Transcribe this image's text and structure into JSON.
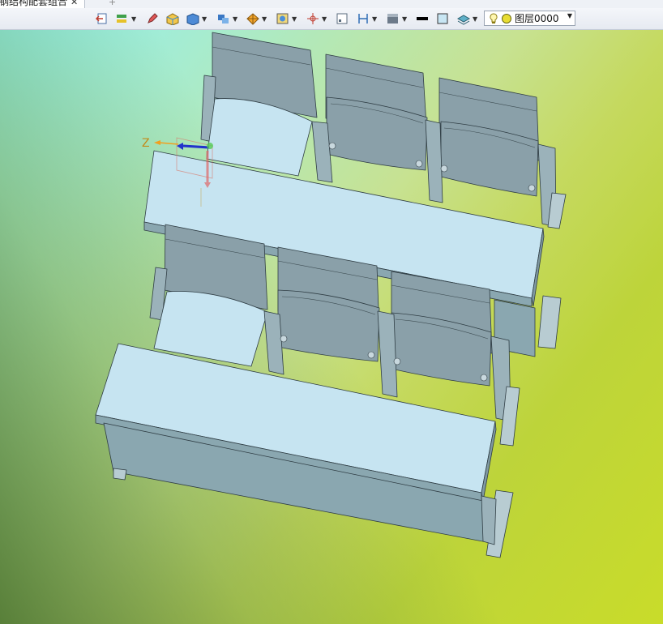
{
  "tab": {
    "title": "钢结构配套组合",
    "close": "✕",
    "add": "+"
  },
  "toolbar": {
    "layer_label": "图层0000",
    "icons": [
      "exit-icon",
      "layer-tool-icon",
      "pen-icon",
      "box-color-icon",
      "solid-icon",
      "render-icon",
      "sphere-icon",
      "view-icon",
      "axis-icon",
      "frame-icon",
      "section-icon",
      "shade-icon",
      "line-width-icon",
      "color-box-icon",
      "layer-stack-icon",
      "bulb-icon",
      "layer-color-icon"
    ]
  },
  "axis": {
    "label": "Z"
  },
  "colors": {
    "panel": "#c6e4f1",
    "panel_dark": "#8aa7b0",
    "seat": "#8aa0a9",
    "edge": "#2f3d44"
  }
}
